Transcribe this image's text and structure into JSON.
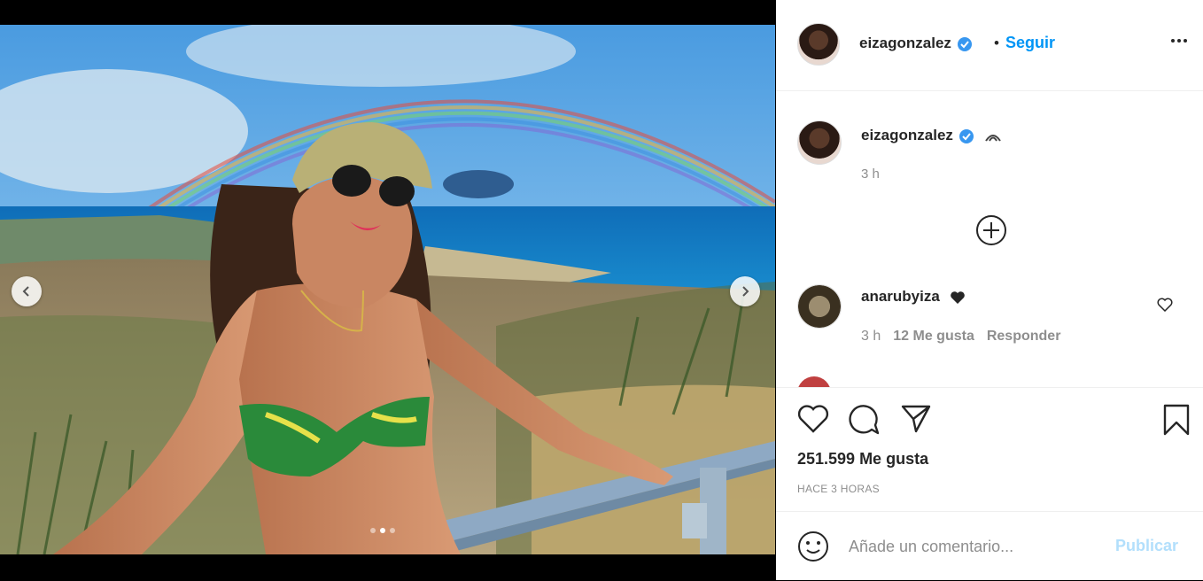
{
  "photo": {
    "slide_count": 3,
    "active_slide": 2
  },
  "header": {
    "username": "eizagonzalez",
    "separator": "•",
    "follow_label": "Seguir"
  },
  "caption": {
    "username": "eizagonzalez",
    "time": "3 h"
  },
  "comment": {
    "username": "anarubyiza",
    "time": "3 h",
    "likes": "12 Me gusta",
    "reply_label": "Responder"
  },
  "post": {
    "likes": "251.599 Me gusta",
    "date": "HACE 3 HORAS"
  },
  "composer": {
    "placeholder": "Añade un comentario...",
    "publish_label": "Publicar"
  },
  "colors": {
    "accent": "#0095f6",
    "publish_disabled": "#b2dffc",
    "text": "#262626",
    "muted": "#8e8e8e"
  },
  "icons": [
    "verified-badge-icon",
    "more-options-icon",
    "plus-circle-icon",
    "heart-icon",
    "comment-icon",
    "share-icon",
    "bookmark-icon",
    "emoji-icon",
    "black-heart-icon",
    "rainbow-icon",
    "chevron-left-icon",
    "chevron-right-icon"
  ]
}
